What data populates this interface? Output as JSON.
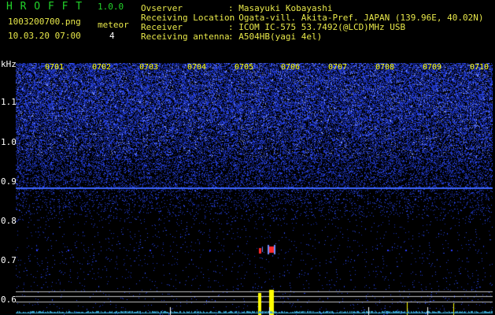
{
  "header": {
    "app_name": "H R O F F T",
    "version": "1.0.0",
    "filename": "1003200700.png",
    "datetime": "10.03.20 07:00",
    "meteor_label": "meteor",
    "meteor_count": "4",
    "fields": [
      {
        "label": "Ovserver",
        "value": ": Masayuki Kobayashi"
      },
      {
        "label": "Receiving Location",
        "value": ": Ogata-vill. Akita-Pref. JAPAN (139.96E, 40.02N)"
      },
      {
        "label": "Receiver",
        "value": ": ICOM IC-575 53.7492(@LCD)MHz USB"
      },
      {
        "label": "Receiving antenna",
        "value": ": A504HB(yagi 4el)"
      }
    ]
  },
  "axis": {
    "unit": "kHz",
    "y_ticks": [
      "1.1",
      "1.0",
      "0.9",
      "0.8",
      "0.7",
      "0.6"
    ],
    "x_ticks": [
      "0701",
      "0702",
      "0703",
      "0704",
      "0705",
      "0706",
      "0707",
      "0708",
      "0709",
      "0710"
    ]
  },
  "colors": {
    "background": "#000000",
    "noise": "#2a3cff",
    "noise_bright": "#8ea0ff",
    "trace_line": "#3d66ff",
    "meteor_red": "#ff2a2a",
    "signal_yellow": "#ffff00",
    "level_lines": "#c0c0c0"
  }
}
